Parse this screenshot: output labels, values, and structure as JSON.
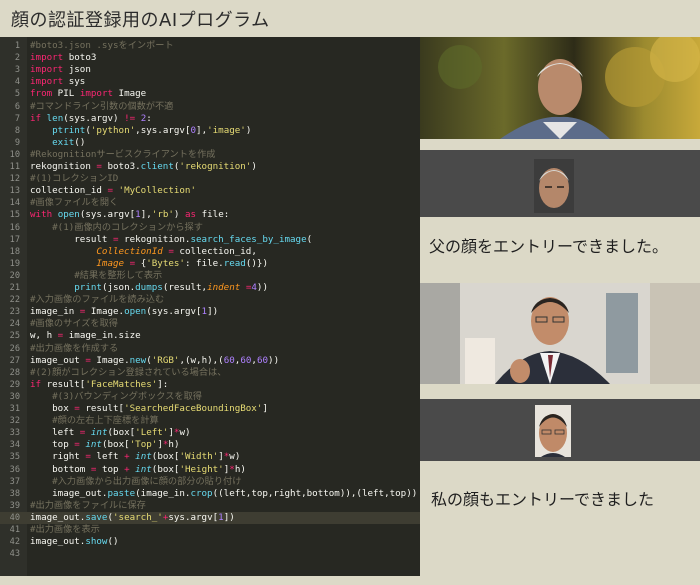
{
  "title": "顔の認証登録用のAIプログラム",
  "editor": {
    "current_line": "40",
    "lines": [
      {
        "n": "1",
        "t": [
          [
            "cm",
            "#boto3.json .sysをインポート"
          ]
        ]
      },
      {
        "n": "2",
        "t": [
          [
            "kw",
            "import"
          ],
          [
            "tx",
            " boto3"
          ]
        ]
      },
      {
        "n": "3",
        "t": [
          [
            "kw",
            "import"
          ],
          [
            "tx",
            " json"
          ]
        ]
      },
      {
        "n": "4",
        "t": [
          [
            "kw",
            "import"
          ],
          [
            "tx",
            " sys"
          ]
        ]
      },
      {
        "n": "5",
        "t": [
          [
            "kw",
            "from"
          ],
          [
            "tx",
            " PIL "
          ],
          [
            "kw",
            "import"
          ],
          [
            "tx",
            " Image"
          ]
        ]
      },
      {
        "n": "6",
        "t": [
          [
            "cm",
            "#コマンドライン引数の個数が不適"
          ]
        ]
      },
      {
        "n": "7",
        "t": [
          [
            "kw",
            "if"
          ],
          [
            "tx",
            " "
          ],
          [
            "fn",
            "len"
          ],
          [
            "tx",
            "(sys.argv) "
          ],
          [
            "kw",
            "!="
          ],
          [
            "tx",
            " "
          ],
          [
            "num",
            "2"
          ],
          [
            "tx",
            ":"
          ]
        ]
      },
      {
        "n": "8",
        "t": [
          [
            "tx",
            "    "
          ],
          [
            "fn",
            "ptrint"
          ],
          [
            "tx",
            "("
          ],
          [
            "str",
            "'python'"
          ],
          [
            "tx",
            ",sys.argv["
          ],
          [
            "num",
            "0"
          ],
          [
            "tx",
            "],"
          ],
          [
            "str",
            "'image'"
          ],
          [
            "tx",
            ")"
          ]
        ]
      },
      {
        "n": "9",
        "t": [
          [
            "tx",
            "    "
          ],
          [
            "fn",
            "exit"
          ],
          [
            "tx",
            "()"
          ]
        ]
      },
      {
        "n": "10",
        "t": [
          [
            "cm",
            "#Rekognitionサービスクライアントを作成"
          ]
        ]
      },
      {
        "n": "11",
        "t": [
          [
            "tx",
            "rekognition "
          ],
          [
            "kw",
            "="
          ],
          [
            "tx",
            " boto3."
          ],
          [
            "fn",
            "client"
          ],
          [
            "tx",
            "("
          ],
          [
            "str",
            "'rekognition'"
          ],
          [
            "tx",
            ")"
          ]
        ]
      },
      {
        "n": "12",
        "t": [
          [
            "cm",
            "#(1)コレクションID"
          ]
        ]
      },
      {
        "n": "13",
        "t": [
          [
            "tx",
            "collection_id "
          ],
          [
            "kw",
            "="
          ],
          [
            "tx",
            " "
          ],
          [
            "str",
            "'MyCollection'"
          ]
        ]
      },
      {
        "n": "14",
        "t": [
          [
            "cm",
            "#画像ファイルを開く"
          ]
        ]
      },
      {
        "n": "15",
        "t": [
          [
            "kw",
            "with"
          ],
          [
            "tx",
            " "
          ],
          [
            "fn",
            "open"
          ],
          [
            "tx",
            "(sys.argv["
          ],
          [
            "num",
            "1"
          ],
          [
            "tx",
            "],"
          ],
          [
            "str",
            "'rb'"
          ],
          [
            "tx",
            ") "
          ],
          [
            "kw",
            "as"
          ],
          [
            "tx",
            " file:"
          ]
        ]
      },
      {
        "n": "16",
        "t": [
          [
            "tx",
            "    "
          ],
          [
            "cm",
            "#(1)画像内のコレクションから探す"
          ]
        ]
      },
      {
        "n": "17",
        "t": [
          [
            "tx",
            "        result "
          ],
          [
            "kw",
            "="
          ],
          [
            "tx",
            " rekognition."
          ],
          [
            "fn",
            "search_faces_by_image"
          ],
          [
            "tx",
            "("
          ]
        ]
      },
      {
        "n": "18",
        "t": [
          [
            "tx",
            "            "
          ],
          [
            "it",
            "CollectionId"
          ],
          [
            "tx",
            " "
          ],
          [
            "kw",
            "="
          ],
          [
            "tx",
            " collection_id,"
          ]
        ]
      },
      {
        "n": "19",
        "t": [
          [
            "tx",
            "            "
          ],
          [
            "it",
            "Image"
          ],
          [
            "tx",
            " "
          ],
          [
            "kw",
            "="
          ],
          [
            "tx",
            " {"
          ],
          [
            "str",
            "'Bytes'"
          ],
          [
            "tx",
            ": file."
          ],
          [
            "fn",
            "read"
          ],
          [
            "tx",
            "()})"
          ]
        ]
      },
      {
        "n": "20",
        "t": [
          [
            "tx",
            "        "
          ],
          [
            "cm",
            "#結果を整形して表示"
          ]
        ]
      },
      {
        "n": "21",
        "t": [
          [
            "tx",
            "        "
          ],
          [
            "fn",
            "print"
          ],
          [
            "tx",
            "(json."
          ],
          [
            "fn",
            "dumps"
          ],
          [
            "tx",
            "(result,"
          ],
          [
            "it",
            "indent"
          ],
          [
            "tx",
            " "
          ],
          [
            "kw",
            "="
          ],
          [
            "num",
            "4"
          ],
          [
            "tx",
            "))"
          ]
        ]
      },
      {
        "n": "22",
        "t": [
          [
            "cm",
            "#入力画像のファイルを読み込む"
          ]
        ]
      },
      {
        "n": "23",
        "t": [
          [
            "tx",
            "image_in "
          ],
          [
            "kw",
            "="
          ],
          [
            "tx",
            " Image."
          ],
          [
            "fn",
            "open"
          ],
          [
            "tx",
            "(sys.argv["
          ],
          [
            "num",
            "1"
          ],
          [
            "tx",
            "])"
          ]
        ]
      },
      {
        "n": "24",
        "t": [
          [
            "cm",
            "#画像のサイズを取得"
          ]
        ]
      },
      {
        "n": "25",
        "t": [
          [
            "tx",
            "w, h "
          ],
          [
            "kw",
            "="
          ],
          [
            "tx",
            " image_in.size"
          ]
        ]
      },
      {
        "n": "26",
        "t": [
          [
            "cm",
            "#出力画像を作成する"
          ]
        ]
      },
      {
        "n": "27",
        "t": [
          [
            "tx",
            "image_out "
          ],
          [
            "kw",
            "="
          ],
          [
            "tx",
            " Image."
          ],
          [
            "fn",
            "new"
          ],
          [
            "tx",
            "("
          ],
          [
            "str",
            "'RGB'"
          ],
          [
            "tx",
            ",(w,h),("
          ],
          [
            "num",
            "60"
          ],
          [
            "tx",
            ","
          ],
          [
            "num",
            "60"
          ],
          [
            "tx",
            ","
          ],
          [
            "num",
            "60"
          ],
          [
            "tx",
            "))"
          ]
        ]
      },
      {
        "n": "28",
        "t": [
          [
            "cm",
            "#(2)顔がコレクション登録されている場合は、"
          ]
        ]
      },
      {
        "n": "29",
        "t": [
          [
            "kw",
            "if"
          ],
          [
            "tx",
            " result["
          ],
          [
            "str",
            "'FaceMatches'"
          ],
          [
            "tx",
            "]:"
          ]
        ]
      },
      {
        "n": "30",
        "t": [
          [
            "tx",
            "    "
          ],
          [
            "cm",
            "#(3)バウンディングボックスを取得"
          ]
        ]
      },
      {
        "n": "31",
        "t": [
          [
            "tx",
            "    box "
          ],
          [
            "kw",
            "="
          ],
          [
            "tx",
            " result["
          ],
          [
            "str",
            "'SearchedFaceBoundingBox'"
          ],
          [
            "tx",
            "]"
          ]
        ]
      },
      {
        "n": "32",
        "t": [
          [
            "tx",
            "    "
          ],
          [
            "cm",
            "#顔の左右上下座標を計算"
          ]
        ]
      },
      {
        "n": "33",
        "t": [
          [
            "tx",
            "    left "
          ],
          [
            "kw",
            "="
          ],
          [
            "tx",
            " "
          ],
          [
            "itb",
            "int"
          ],
          [
            "tx",
            "(box["
          ],
          [
            "str",
            "'Left'"
          ],
          [
            "tx",
            "]"
          ],
          [
            "kw",
            "*"
          ],
          [
            "tx",
            "w)"
          ]
        ]
      },
      {
        "n": "34",
        "t": [
          [
            "tx",
            "    top "
          ],
          [
            "kw",
            "="
          ],
          [
            "tx",
            " "
          ],
          [
            "itb",
            "int"
          ],
          [
            "tx",
            "(box["
          ],
          [
            "str",
            "'Top'"
          ],
          [
            "tx",
            "]"
          ],
          [
            "kw",
            "*"
          ],
          [
            "tx",
            "h)"
          ]
        ]
      },
      {
        "n": "35",
        "t": [
          [
            "tx",
            "    right "
          ],
          [
            "kw",
            "="
          ],
          [
            "tx",
            " left "
          ],
          [
            "kw",
            "+"
          ],
          [
            "tx",
            " "
          ],
          [
            "itb",
            "int"
          ],
          [
            "tx",
            "(box["
          ],
          [
            "str",
            "'Width'"
          ],
          [
            "tx",
            "]"
          ],
          [
            "kw",
            "*"
          ],
          [
            "tx",
            "w)"
          ]
        ]
      },
      {
        "n": "36",
        "t": [
          [
            "tx",
            "    bottom "
          ],
          [
            "kw",
            "="
          ],
          [
            "tx",
            " top "
          ],
          [
            "kw",
            "+"
          ],
          [
            "tx",
            " "
          ],
          [
            "itb",
            "int"
          ],
          [
            "tx",
            "(box["
          ],
          [
            "str",
            "'Height'"
          ],
          [
            "tx",
            "]"
          ],
          [
            "kw",
            "*"
          ],
          [
            "tx",
            "h)"
          ]
        ]
      },
      {
        "n": "37",
        "t": [
          [
            "tx",
            "    "
          ],
          [
            "cm",
            "#入力画像から出力画像に顔の部分の貼り付け"
          ]
        ]
      },
      {
        "n": "38",
        "t": [
          [
            "tx",
            "    image_out."
          ],
          [
            "fn",
            "paste"
          ],
          [
            "tx",
            "(image_in."
          ],
          [
            "fn",
            "crop"
          ],
          [
            "tx",
            "((left,top,right,bottom)),(left,top))"
          ]
        ]
      },
      {
        "n": "39",
        "t": [
          [
            "cm",
            "#出力画像をファイルに保存"
          ]
        ]
      },
      {
        "n": "40",
        "t": [
          [
            "tx",
            "image_out."
          ],
          [
            "fn",
            "save"
          ],
          [
            "tx",
            "("
          ],
          [
            "str",
            "'search_'"
          ],
          [
            "kw",
            "+"
          ],
          [
            "tx",
            "sys.argv["
          ],
          [
            "num",
            "1"
          ],
          [
            "tx",
            "])"
          ]
        ]
      },
      {
        "n": "41",
        "t": [
          [
            "cm",
            "#出力画像を表示"
          ]
        ]
      },
      {
        "n": "42",
        "t": [
          [
            "tx",
            "image_out."
          ],
          [
            "fn",
            "show"
          ],
          [
            "tx",
            "()"
          ]
        ]
      },
      {
        "n": "43",
        "t": []
      }
    ]
  },
  "results": {
    "father_message": "父の顔をエントリーできました。",
    "my_message": "私の顔もエントリーできました"
  },
  "colors": {
    "background": "#dcd9c7",
    "editor_bg": "#272822",
    "keyword": "#f92672",
    "function": "#66d9ef",
    "string": "#e6db74",
    "number": "#ae81ff",
    "comment": "#75715e"
  }
}
